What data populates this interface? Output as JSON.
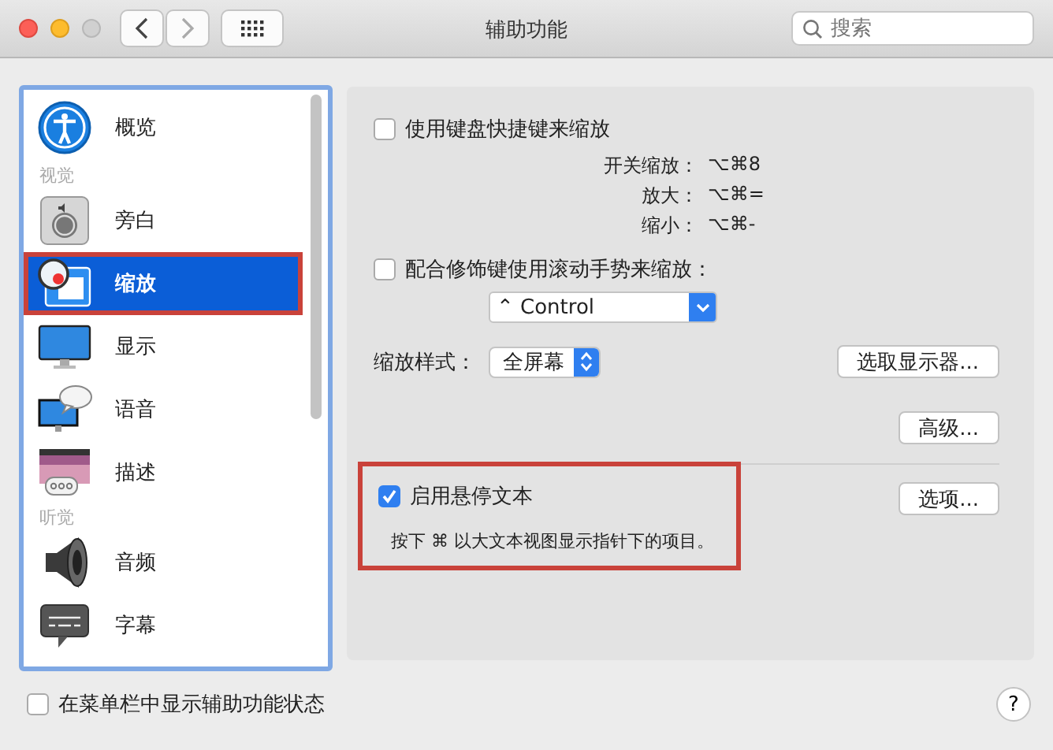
{
  "window": {
    "title": "辅助功能",
    "search": {
      "placeholder": "搜索"
    }
  },
  "sidebar": {
    "items": [
      {
        "kind": "item",
        "label": "概览",
        "selected": false,
        "highlighted": false
      },
      {
        "kind": "header",
        "label": "视觉"
      },
      {
        "kind": "item",
        "label": "旁白",
        "selected": false,
        "highlighted": false
      },
      {
        "kind": "item",
        "label": "缩放",
        "selected": true,
        "highlighted": true
      },
      {
        "kind": "item",
        "label": "显示",
        "selected": false,
        "highlighted": false
      },
      {
        "kind": "item",
        "label": "语音",
        "selected": false,
        "highlighted": false
      },
      {
        "kind": "item",
        "label": "描述",
        "selected": false,
        "highlighted": false
      },
      {
        "kind": "header",
        "label": "听觉"
      },
      {
        "kind": "item",
        "label": "音频",
        "selected": false,
        "highlighted": false
      },
      {
        "kind": "item",
        "label": "字幕",
        "selected": false,
        "highlighted": false
      }
    ]
  },
  "zoom": {
    "keyboard_shortcuts": {
      "label": "使用键盘快捷键来缩放",
      "checked": false
    },
    "shortcuts": [
      {
        "label": "开关缩放：",
        "keys": "⌥⌘8"
      },
      {
        "label": "放大：",
        "keys": "⌥⌘="
      },
      {
        "label": "缩小：",
        "keys": "⌥⌘-"
      }
    ],
    "scroll_gesture": {
      "label": "配合修饰键使用滚动手势来缩放：",
      "checked": false,
      "modifier": "⌃ Control"
    },
    "zoom_style": {
      "label": "缩放样式：",
      "value": "全屏幕"
    },
    "choose_display_button": "选取显示器...",
    "advanced_button": "高级...",
    "hover_text": {
      "label": "启用悬停文本",
      "checked": true,
      "highlighted": true,
      "hint": "按下 ⌘ 以大文本视图显示指针下的项目。",
      "options_button": "选项..."
    }
  },
  "footer": {
    "show_in_menu_bar": {
      "label": "在菜单栏中显示辅助功能状态",
      "checked": false
    },
    "help_button": "?"
  }
}
